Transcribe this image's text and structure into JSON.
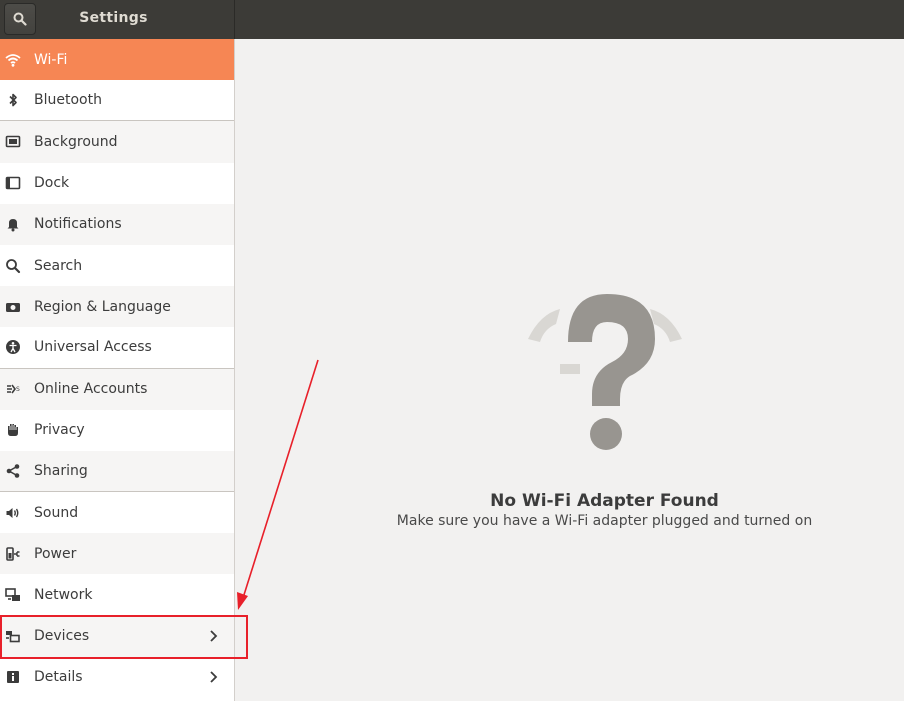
{
  "header": {
    "title": "Settings",
    "search_icon": "search-icon"
  },
  "sidebar": {
    "items": [
      {
        "label": "Wi-Fi",
        "icon": "wifi-icon",
        "state": "selected"
      },
      {
        "label": "Bluetooth",
        "icon": "bluetooth-icon"
      },
      {
        "label": "Background",
        "icon": "background-icon"
      },
      {
        "label": "Dock",
        "icon": "dock-icon"
      },
      {
        "label": "Notifications",
        "icon": "bell-icon"
      },
      {
        "label": "Search",
        "icon": "search-icon"
      },
      {
        "label": "Region & Language",
        "icon": "camera-icon"
      },
      {
        "label": "Universal Access",
        "icon": "accessibility-icon"
      },
      {
        "label": "Online Accounts",
        "icon": "online-accounts-icon"
      },
      {
        "label": "Privacy",
        "icon": "hand-icon"
      },
      {
        "label": "Sharing",
        "icon": "share-icon"
      },
      {
        "label": "Sound",
        "icon": "speaker-icon"
      },
      {
        "label": "Power",
        "icon": "power-icon"
      },
      {
        "label": "Network",
        "icon": "network-icon"
      },
      {
        "label": "Devices",
        "icon": "devices-icon",
        "chevron": true
      },
      {
        "label": "Details",
        "icon": "info-icon",
        "chevron": true
      }
    ]
  },
  "main": {
    "placeholder_icon": "question-mark-icon",
    "title": "No Wi-Fi Adapter Found",
    "subtitle": "Make sure you have a Wi-Fi adapter plugged and turned on"
  },
  "colors": {
    "accent": "#f68654",
    "header": "#3c3b37",
    "annotation": "#e8202a"
  }
}
